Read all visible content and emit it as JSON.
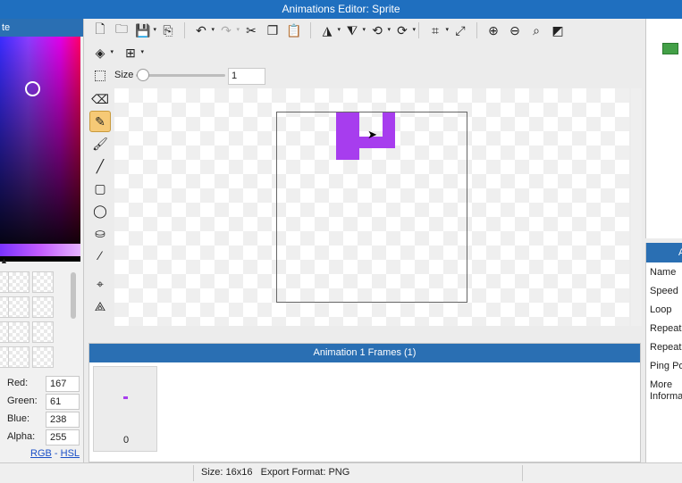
{
  "window": {
    "title": "Animations Editor: Sprite"
  },
  "color_panel": {
    "header": "te",
    "red_label": "Red:",
    "red_value": "167",
    "green_label": "Green:",
    "green_value": "61",
    "blue_label": "Blue:",
    "blue_value": "238",
    "alpha_label": "Alpha:",
    "alpha_value": "255",
    "link_rgb": "RGB",
    "link_sep": " - ",
    "link_hsl": "HSL"
  },
  "toolbar": {
    "size_label": "Size",
    "size_value": "1"
  },
  "frames": {
    "header": "Animation 1 Frames (1)",
    "items": [
      {
        "number": "0"
      }
    ]
  },
  "properties": {
    "header": "A",
    "labels": [
      "Name",
      "Speed",
      "Loop",
      "Repeat",
      "Repeat",
      "Ping Po",
      "More",
      "Informa"
    ]
  },
  "status": {
    "text": "Size: 16x16   Export Format: PNG"
  },
  "colors": {
    "accent": "#1f6fbf",
    "pixel": "#a73dee",
    "active_tool": "#f6c976"
  }
}
